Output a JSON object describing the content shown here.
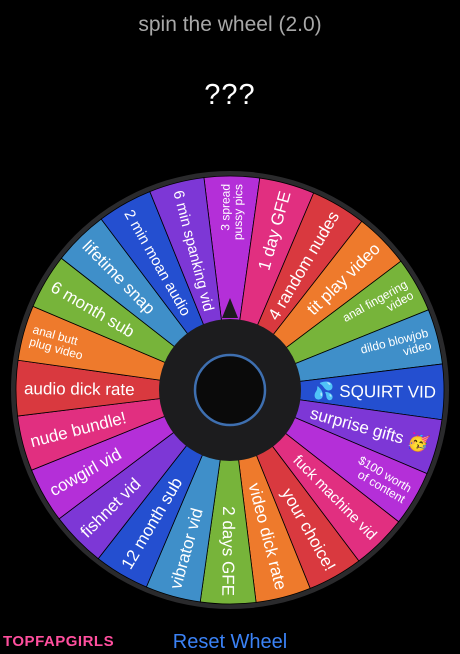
{
  "header": {
    "title": "spin the wheel (2.0)"
  },
  "result": {
    "text": "???"
  },
  "wheel": {
    "segments": [
      {
        "label": "3 spread pussy pics",
        "color": "#b42fd8"
      },
      {
        "label": "1 day GFE",
        "color": "#e12f80"
      },
      {
        "label": "4 random nudes",
        "color": "#d9393f"
      },
      {
        "label": "tit play video",
        "color": "#ee7a2c"
      },
      {
        "label": "anal fingering video",
        "color": "#77b43a"
      },
      {
        "label": "dildo blowjob video",
        "color": "#3f8fc9"
      },
      {
        "label": "💦 SQUIRT VID",
        "color": "#244fd0"
      },
      {
        "label": "surprise gifts 🥳",
        "color": "#7d37d6"
      },
      {
        "label": "$100 worth of content",
        "color": "#b42fd8"
      },
      {
        "label": "fuck machine vid",
        "color": "#e12f80"
      },
      {
        "label": "your choice!",
        "color": "#d9393f"
      },
      {
        "label": "video dick rate",
        "color": "#ee7a2c"
      },
      {
        "label": "2 days GFE",
        "color": "#77b43a"
      },
      {
        "label": "vibrator vid",
        "color": "#3f8fc9"
      },
      {
        "label": "12 month sub",
        "color": "#244fd0"
      },
      {
        "label": "fishnet vid",
        "color": "#7d37d6"
      },
      {
        "label": "cowgirl vid",
        "color": "#b42fd8"
      },
      {
        "label": "nude bundle!",
        "color": "#e12f80"
      },
      {
        "label": "audio dick rate",
        "color": "#d9393f"
      },
      {
        "label": "anal butt plug video",
        "color": "#ee7a2c"
      },
      {
        "label": "6 month sub",
        "color": "#77b43a"
      },
      {
        "label": "lifetime snap",
        "color": "#3f8fc9"
      },
      {
        "label": "2 min moan audio",
        "color": "#244fd0"
      },
      {
        "label": "6 min spanking vid",
        "color": "#7d37d6"
      }
    ]
  },
  "footer": {
    "reset_label": "Reset Wheel"
  },
  "watermark": {
    "text": "TOPFAPGIRLS"
  }
}
